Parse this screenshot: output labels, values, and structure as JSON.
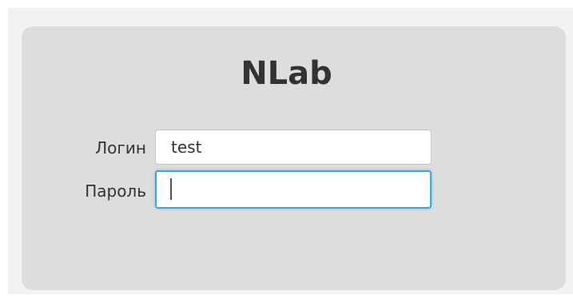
{
  "app": {
    "title": "NLab"
  },
  "form": {
    "login": {
      "label": "Логин",
      "value": "test"
    },
    "password": {
      "label": "Пароль",
      "value": ""
    }
  },
  "colors": {
    "panel_background": "#dddddd",
    "outer_background": "#f2f2f2",
    "focus_border": "#38a8d8",
    "text": "#333333"
  }
}
